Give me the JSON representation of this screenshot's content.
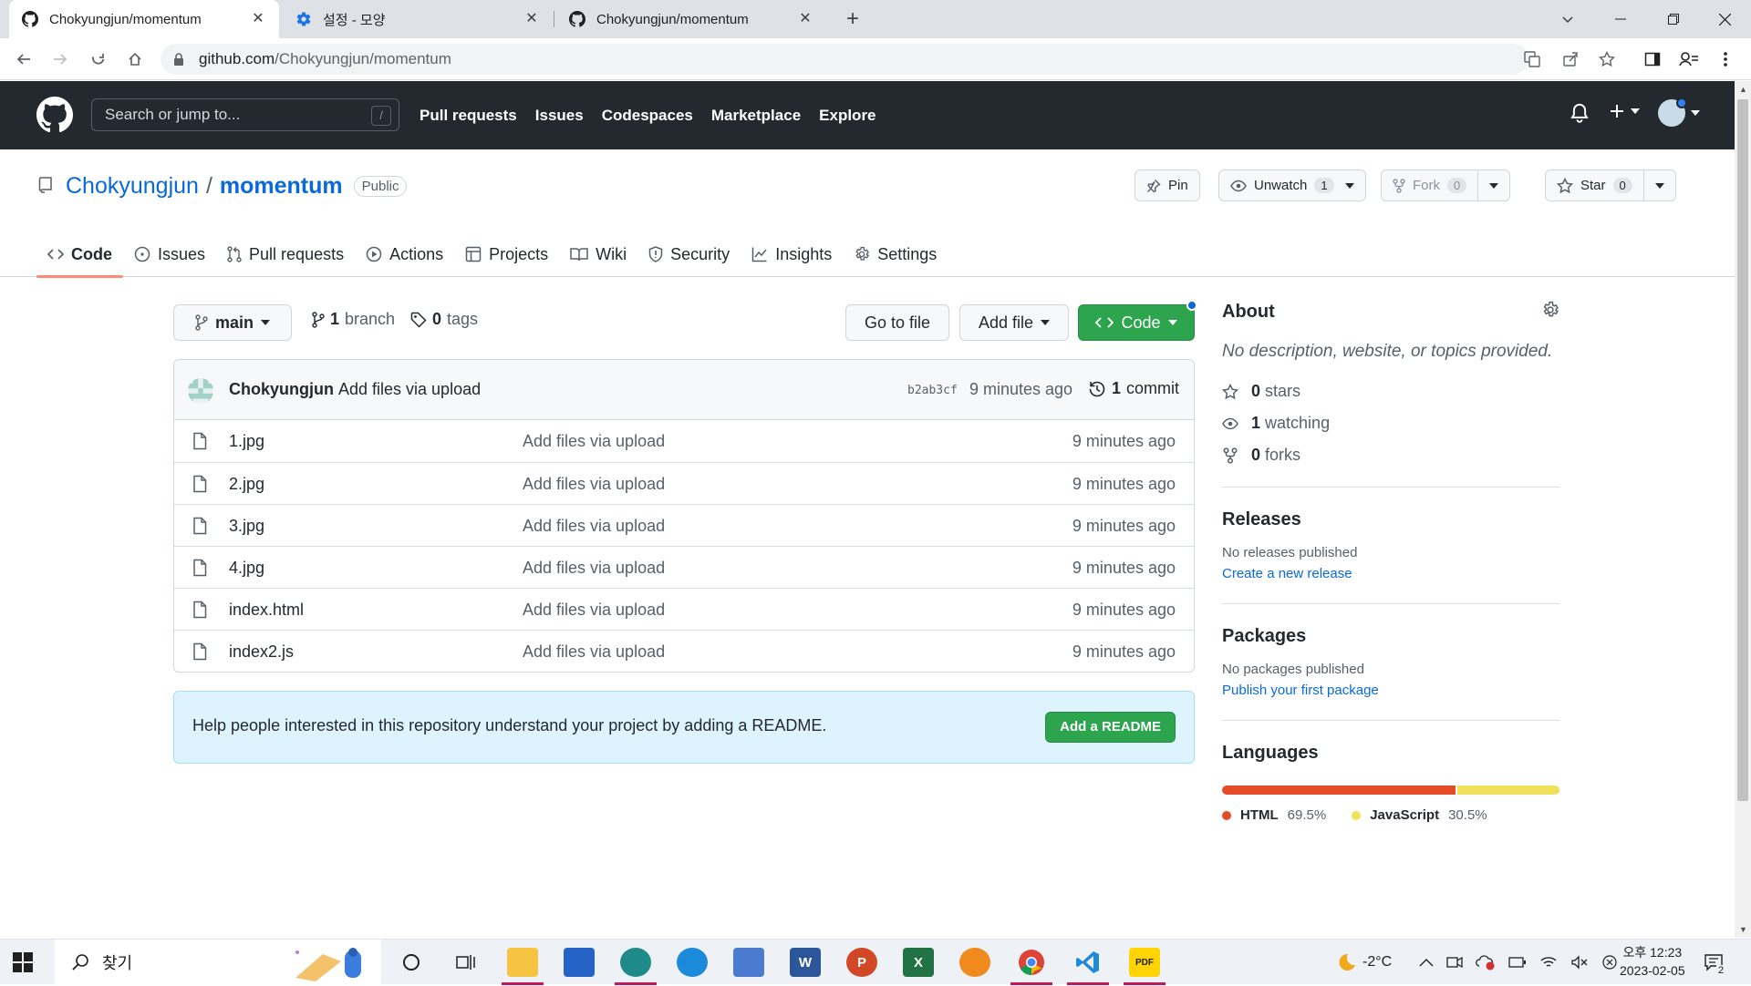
{
  "browser": {
    "tabs": [
      {
        "title": "Chokyungjun/momentum",
        "active": true,
        "icon": "github-icon"
      },
      {
        "title": "설정 - 모양",
        "active": false,
        "icon": "settings-gear-icon"
      },
      {
        "title": "Chokyungjun/momentum",
        "active": false,
        "icon": "github-icon"
      }
    ],
    "close_glyph": "✕",
    "new_tab_glyph": "+",
    "url_host": "github.com",
    "url_path": "/Chokyungjun/momentum"
  },
  "github": {
    "search_placeholder": "Search or jump to...",
    "search_shortcut": "/",
    "nav": [
      "Pull requests",
      "Issues",
      "Codespaces",
      "Marketplace",
      "Explore"
    ]
  },
  "repo": {
    "owner": "Chokyungjun",
    "separator": "/",
    "name": "momentum",
    "visibility": "Public",
    "actions": {
      "pin": "Pin",
      "unwatch": "Unwatch",
      "watch_count": "1",
      "fork": "Fork",
      "fork_count": "0",
      "star": "Star",
      "star_count": "0"
    },
    "tabs": [
      "Code",
      "Issues",
      "Pull requests",
      "Actions",
      "Projects",
      "Wiki",
      "Security",
      "Insights",
      "Settings"
    ],
    "selected_tab": "Code"
  },
  "main": {
    "branch": "main",
    "branch_count": "1",
    "branch_label": "branch",
    "tag_count": "0",
    "tag_label": "tags",
    "go_to_file": "Go to file",
    "add_file": "Add file",
    "code_button": "Code",
    "commit": {
      "author": "Chokyungjun",
      "message": "Add files via upload",
      "sha": "b2ab3cf",
      "time": "9 minutes ago",
      "count": "1",
      "count_label": "commit"
    },
    "files": [
      {
        "name": "1.jpg",
        "message": "Add files via upload",
        "age": "9 minutes ago"
      },
      {
        "name": "2.jpg",
        "message": "Add files via upload",
        "age": "9 minutes ago"
      },
      {
        "name": "3.jpg",
        "message": "Add files via upload",
        "age": "9 minutes ago"
      },
      {
        "name": "4.jpg",
        "message": "Add files via upload",
        "age": "9 minutes ago"
      },
      {
        "name": "index.html",
        "message": "Add files via upload",
        "age": "9 minutes ago"
      },
      {
        "name": "index2.js",
        "message": "Add files via upload",
        "age": "9 minutes ago"
      }
    ],
    "readme_prompt": "Help people interested in this repository understand your project by adding a README.",
    "readme_button": "Add a README"
  },
  "sidebar": {
    "about_title": "About",
    "about_desc": "No description, website, or topics provided.",
    "stats": [
      {
        "icon": "star-icon",
        "value": "0",
        "label": "stars"
      },
      {
        "icon": "eye-icon",
        "value": "1",
        "label": "watching"
      },
      {
        "icon": "fork-icon",
        "value": "0",
        "label": "forks"
      }
    ],
    "releases_title": "Releases",
    "releases_none": "No releases published",
    "releases_link": "Create a new release",
    "packages_title": "Packages",
    "packages_none": "No packages published",
    "packages_link": "Publish your first package",
    "languages_title": "Languages",
    "languages": [
      {
        "name": "HTML",
        "percent": "69.5%",
        "share": 69.5,
        "color": "#e34c26"
      },
      {
        "name": "JavaScript",
        "percent": "30.5%",
        "share": 30.5,
        "color": "#f1e05a"
      }
    ]
  },
  "taskbar": {
    "search_label": "찾기",
    "weather": "-2°C",
    "time": "오후 12:23",
    "date": "2023-02-05",
    "notification_count": "2"
  },
  "colors": {
    "github_header": "#24292f",
    "link": "#0969da",
    "green": "#2da44e",
    "tab_underline": "#fd8c73"
  }
}
